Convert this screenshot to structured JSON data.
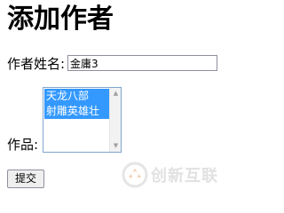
{
  "form": {
    "title": "添加作者",
    "author_name_label": "作者姓名:",
    "author_name_value": "金庸3",
    "works_label": "作品:",
    "works_options": [
      {
        "label": "天龙八部",
        "selected": true
      },
      {
        "label": "射雕英雄壮",
        "selected": true
      }
    ],
    "submit_label": "提交"
  },
  "watermark": {
    "text": "创新互联",
    "icon": "brand-logo-icon"
  },
  "colors": {
    "selection": "#3399ff",
    "listbox_border": "#7fa5cf"
  }
}
